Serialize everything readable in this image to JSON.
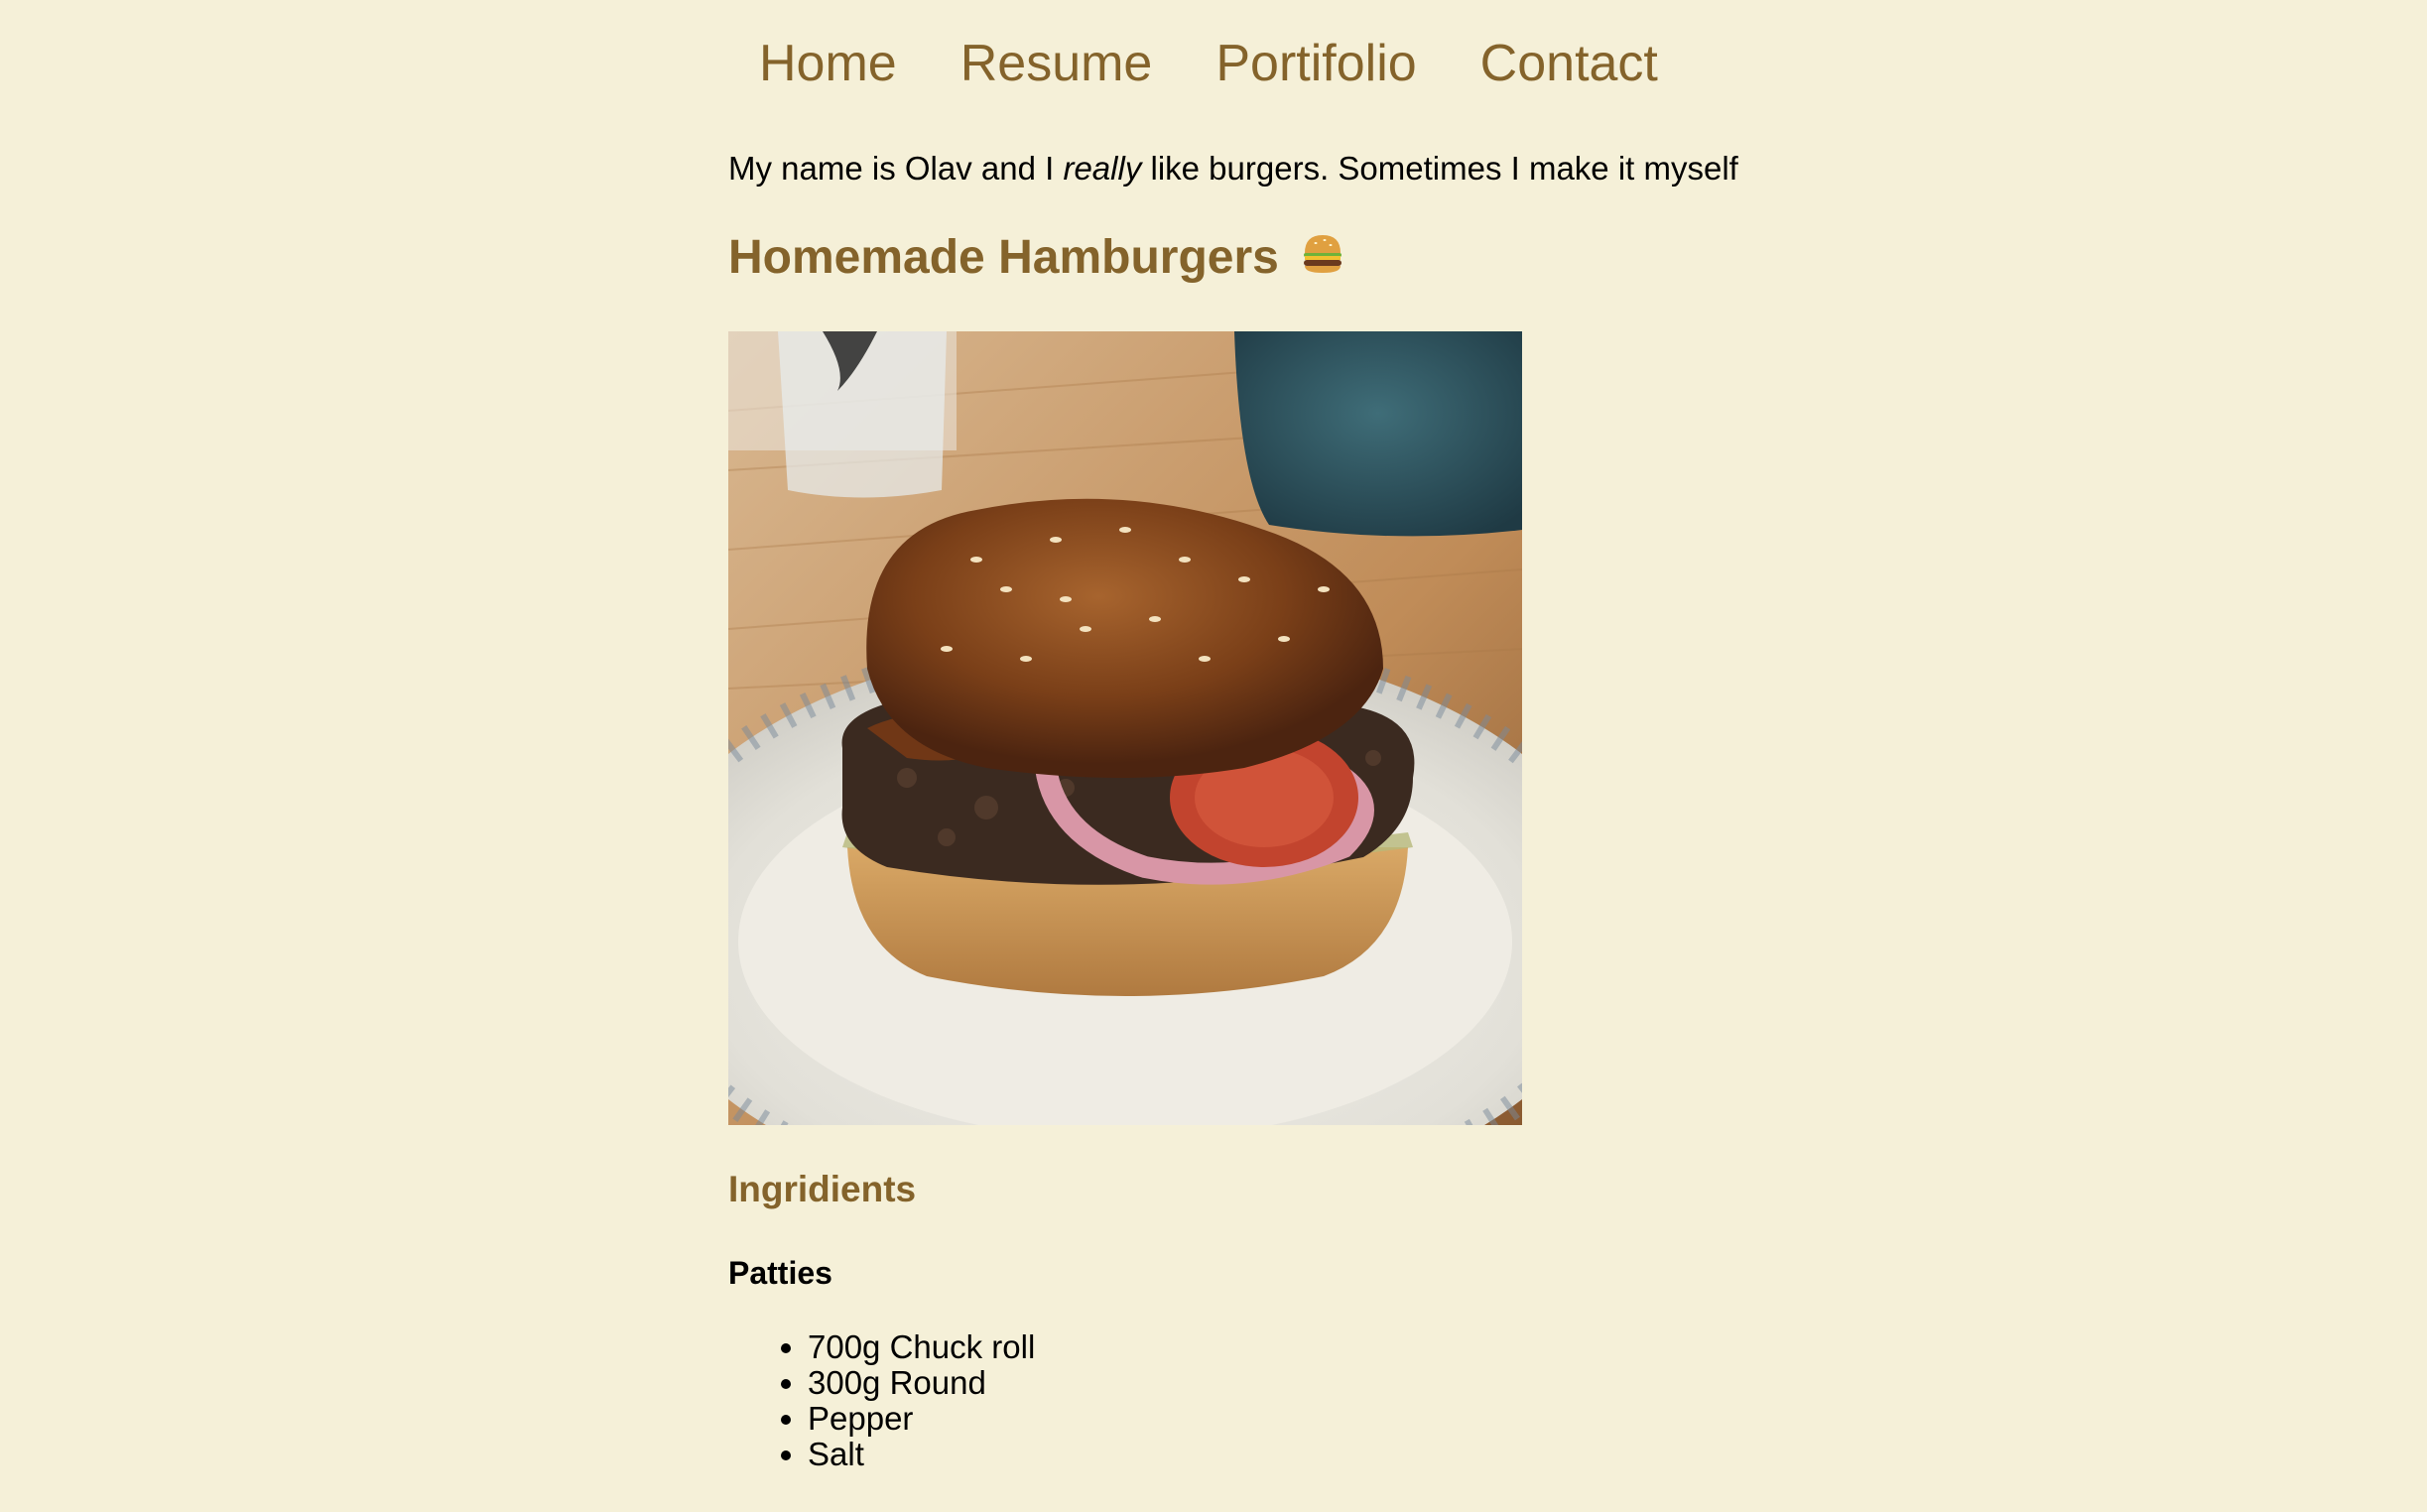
{
  "nav": {
    "items": [
      {
        "label": "Home"
      },
      {
        "label": "Resume"
      },
      {
        "label": "Portifolio"
      },
      {
        "label": "Contact"
      }
    ]
  },
  "intro": {
    "before": "My name is Olav and I ",
    "emphasis": "really",
    "after": " like burgers. Sometimes I make it myself"
  },
  "recipe": {
    "title": "Homemade Hamburgers",
    "title_icon": "hamburger-emoji",
    "photo_icon": "burger-photo",
    "ingredients_heading": "Ingridients",
    "patties_heading": "Patties",
    "patties": [
      "700g Chuck roll",
      "300g Round",
      "Pepper",
      "Salt"
    ]
  },
  "colors": {
    "background": "#f5f0d8",
    "accent": "#84632b",
    "text": "#000000"
  }
}
